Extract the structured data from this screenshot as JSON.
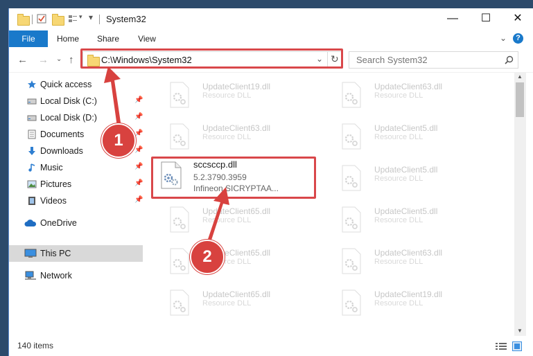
{
  "window": {
    "title": "System32"
  },
  "ribbon": {
    "tabs": [
      "File",
      "Home",
      "Share",
      "View"
    ]
  },
  "address": {
    "path": "C:\\Windows\\System32"
  },
  "search": {
    "placeholder": "Search System32"
  },
  "nav": {
    "items": [
      {
        "label": "Quick access",
        "icon": "star-icon"
      },
      {
        "label": "Local Disk (C:)",
        "icon": "drive-icon"
      },
      {
        "label": "Local Disk (D:)",
        "icon": "drive-icon"
      },
      {
        "label": "Documents",
        "icon": "documents-icon"
      },
      {
        "label": "Downloads",
        "icon": "download-icon"
      },
      {
        "label": "Music",
        "icon": "music-icon"
      },
      {
        "label": "Pictures",
        "icon": "pictures-icon"
      },
      {
        "label": "Videos",
        "icon": "videos-icon"
      },
      {
        "label": "OneDrive",
        "icon": "cloud-icon"
      },
      {
        "label": "This PC",
        "icon": "monitor-icon"
      },
      {
        "label": "Network",
        "icon": "network-icon"
      }
    ]
  },
  "files": {
    "left": [
      {
        "name": "UpdateClient19.dll",
        "type": "Resource DLL"
      },
      {
        "name": "UpdateClient63.dll",
        "type": "Resource DLL"
      },
      {
        "name": "UpdateClient65.dll",
        "type": "Resource DLL"
      },
      {
        "name": "UpdateClient65.dll",
        "type": "Resource DLL"
      },
      {
        "name": "UpdateClient65.dll",
        "type": "Resource DLL"
      }
    ],
    "right": [
      {
        "name": "UpdateClient63.dll",
        "type": "Resource DLL"
      },
      {
        "name": "UpdateClient5.dll",
        "type": "Resource DLL"
      },
      {
        "name": "UpdateClient5.dll",
        "type": "Resource DLL"
      },
      {
        "name": "UpdateClient5.dll",
        "type": "Resource DLL"
      },
      {
        "name": "UpdateClient63.dll",
        "type": "Resource DLL"
      },
      {
        "name": "UpdateClient19.dll",
        "type": "Resource DLL"
      }
    ],
    "highlighted": {
      "name": "sccsccp.dll",
      "version": "5.2.3790.3959",
      "company": "Infineon SICRYPTAA..."
    }
  },
  "status": {
    "count": "140 items"
  },
  "annotations": {
    "step1": "1",
    "step2": "2",
    "color": "#d8423f"
  }
}
